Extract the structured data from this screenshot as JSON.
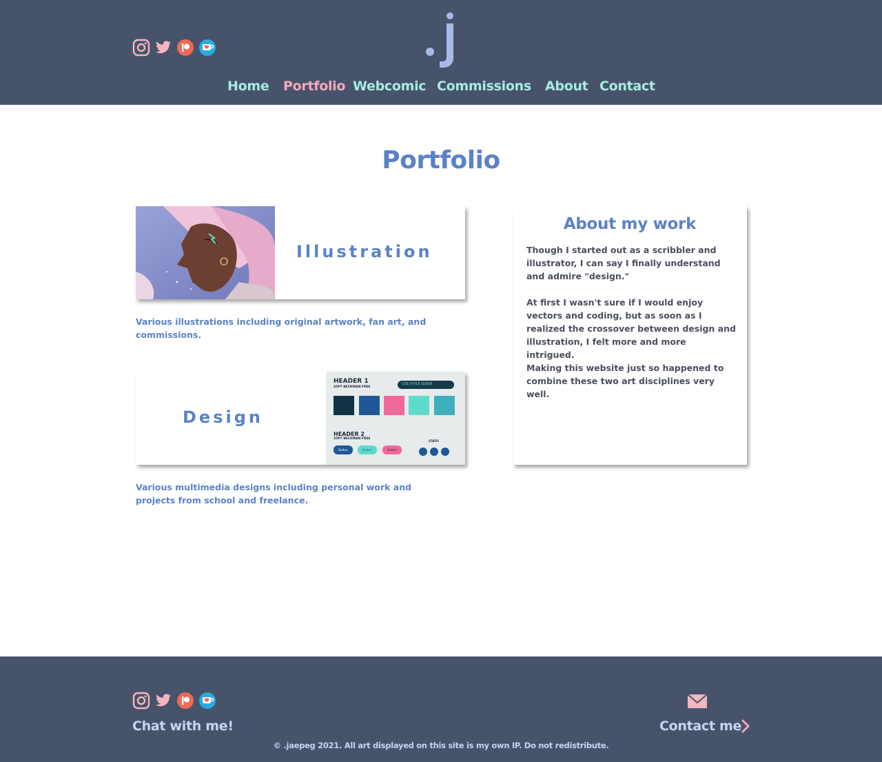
{
  "header": {
    "logo_text": ".j",
    "social": [
      {
        "icon": "instagram-icon"
      },
      {
        "icon": "twitter-icon"
      },
      {
        "icon": "patreon-icon"
      },
      {
        "icon": "kofi-icon"
      }
    ],
    "nav": [
      {
        "label": "Home",
        "active": false
      },
      {
        "label": "Portfolio",
        "active": true
      },
      {
        "label": "Webcomic",
        "active": false
      },
      {
        "label": "Commissions",
        "active": false
      },
      {
        "label": "About",
        "active": false
      },
      {
        "label": "Contact",
        "active": false
      }
    ]
  },
  "main": {
    "title": "Portfolio",
    "illustration": {
      "label": "Illustration",
      "description": "Various illustrations including original artwork, fan art, and commissions."
    },
    "design": {
      "label": "Design",
      "description": "Various multimedia designs including personal work and projects from school and freelance.",
      "thumb": {
        "header1": "HEADER 1",
        "header1_sub": "45PT BECKMAN FREE",
        "guide": "CSS STYLE GUIDE",
        "header2": "HEADER 2",
        "header2_sub": "35PT BECKMAN FREE",
        "button": "Button",
        "static": "STATIC"
      }
    },
    "about": {
      "title": "About my work",
      "paragraphs": [
        "Though I started out as a scribbler and illustrator, I can say I finally understand and admire \"design.\"",
        "At first I wasn't sure if I would enjoy vectors and coding, but as soon as I realized the crossover between design and illustration, I felt more and more intrigued.",
        "Making this website just so happened to combine these two art disciplines very well."
      ]
    }
  },
  "footer": {
    "chat": "Chat with me!",
    "contact": "Contact me",
    "copyright": "© .jaepeg 2021. All art displayed on this site is my own IP. Do not redistribute."
  },
  "colors": {
    "header_bg": "#47536b",
    "accent_blue": "#5b82c7",
    "nav_mint": "#a8ece0",
    "nav_active": "#f4a9bc",
    "icon_pink": "#f4b6bf"
  }
}
